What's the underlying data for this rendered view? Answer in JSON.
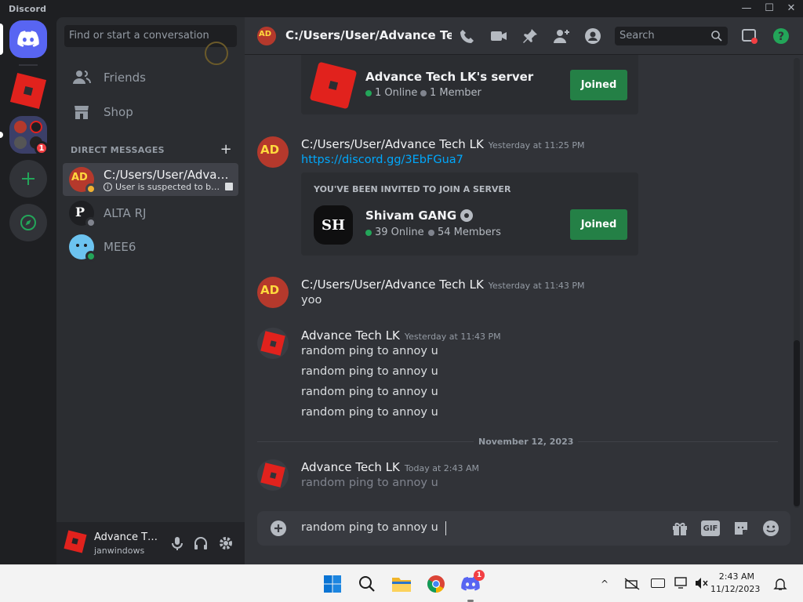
{
  "window": {
    "app_name": "Discord",
    "controls": [
      "—",
      "☐",
      "✕"
    ]
  },
  "rail": {
    "mention_badge": "1"
  },
  "sidebar": {
    "search_placeholder": "Find or start a conversation",
    "nav": [
      {
        "label": "Friends",
        "icon": "friends-icon"
      },
      {
        "label": "Shop",
        "icon": "shop-icon"
      }
    ],
    "dm_header": "DIRECT MESSAGES",
    "dms": [
      {
        "name": "C:/Users/User/Advan…",
        "status_text": "User is suspected to be…",
        "active": true
      },
      {
        "name": "ALTA RJ",
        "active": false
      },
      {
        "name": "MEE6",
        "active": false
      }
    ]
  },
  "user_panel": {
    "name": "Advance T…",
    "tag": "janwindows"
  },
  "header": {
    "title": "C:/Users/User/Advance Tech I",
    "search_placeholder": "Search"
  },
  "messages": {
    "embed1": {
      "server_name": "Advance Tech LK's server",
      "online": "1 Online",
      "members": "1 Member",
      "button": "Joined"
    },
    "m1": {
      "author": "C:/Users/User/Advance Tech LK",
      "time": "Yesterday at 11:25 PM",
      "link": "https://discord.gg/3EbFGua7"
    },
    "embed2": {
      "title": "YOU'VE BEEN INVITED TO JOIN A SERVER",
      "server_name": "Shivam GANG",
      "online": "39 Online",
      "members": "54 Members",
      "button": "Joined"
    },
    "m2": {
      "author": "C:/Users/User/Advance Tech LK",
      "time": "Yesterday at 11:43 PM",
      "text": "yoo"
    },
    "m3": {
      "author": "Advance Tech LK",
      "time": "Yesterday at 11:43 PM",
      "lines": [
        "random ping to annoy u",
        "random ping to annoy u",
        "random ping to annoy u",
        "random ping to annoy u"
      ]
    },
    "divider": "November 12, 2023",
    "m4": {
      "author": "Advance Tech LK",
      "time": "Today at 2:43 AM",
      "text": "random ping to annoy u"
    }
  },
  "composer": {
    "value": "random ping to annoy u",
    "gif_label": "GIF"
  },
  "taskbar": {
    "time": "2:43 AM",
    "date": "11/12/2023",
    "discord_badge": "1"
  }
}
